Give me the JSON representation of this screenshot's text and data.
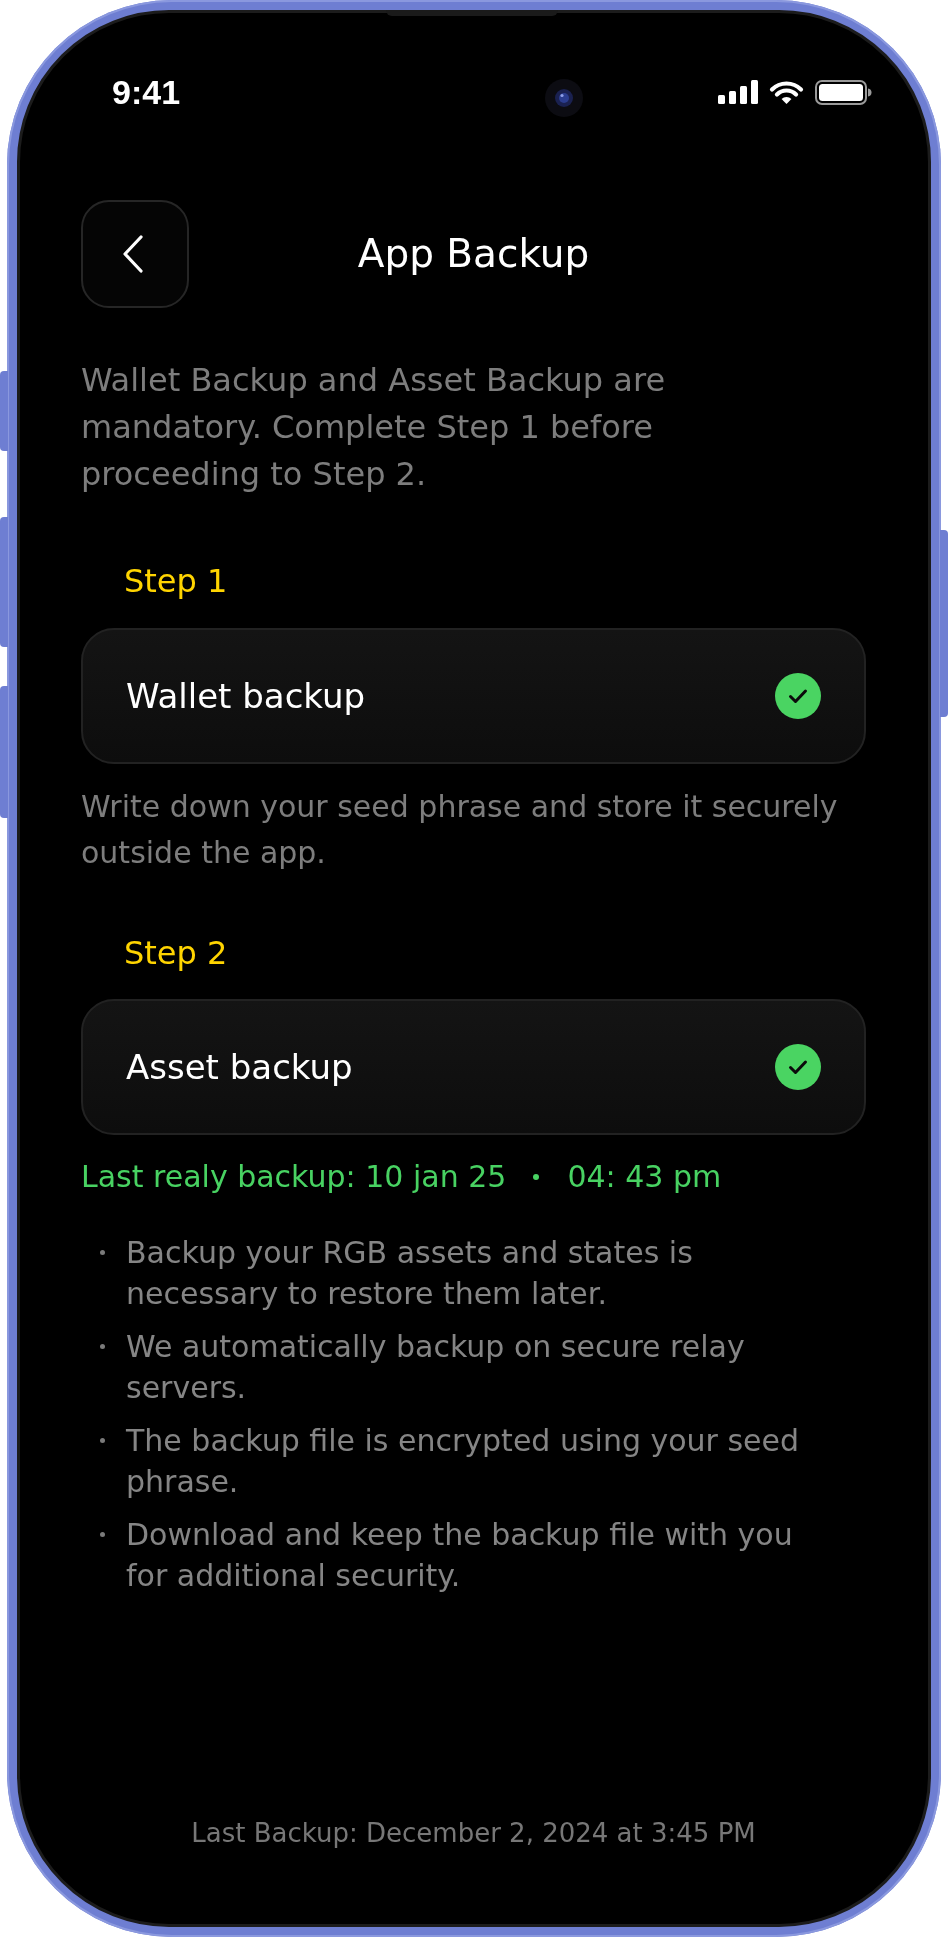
{
  "status_bar": {
    "time": "9:41"
  },
  "header": {
    "title": "App Backup"
  },
  "intro": "Wallet Backup and Asset Backup are mandatory. Complete Step 1 before proceeding to Step 2.",
  "steps": [
    {
      "label": "Step 1",
      "card": {
        "title": "Wallet backup",
        "checked": true
      },
      "description": "Write down your seed phrase and store it securely outside the app."
    },
    {
      "label": "Step 2",
      "card": {
        "title": "Asset backup",
        "checked": true
      },
      "last_backup": {
        "date": "Last realy backup: 10 jan 25",
        "time": "04: 43 pm"
      },
      "notes": [
        "Backup your RGB assets and states is necessary to restore them later.",
        "We automatically backup on secure relay servers.",
        "The backup file is encrypted using your seed phrase.",
        "Download and keep the backup file with you for additional security."
      ]
    }
  ],
  "footer": "Last Backup: December 2, 2024 at 3:45 PM"
}
